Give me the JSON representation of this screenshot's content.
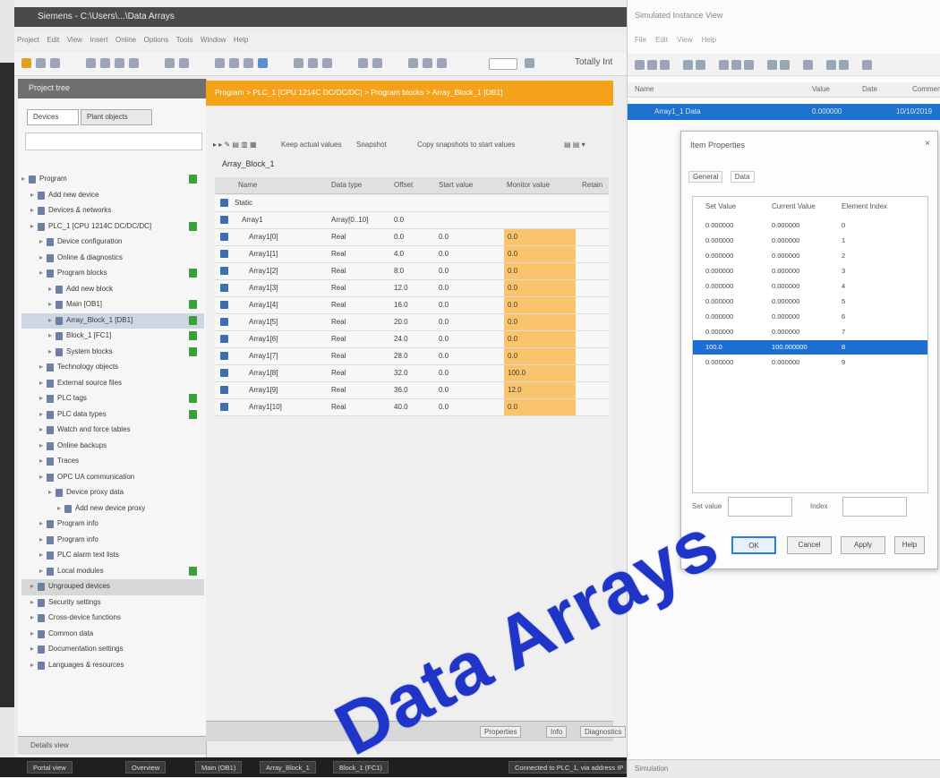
{
  "main_window": {
    "title": "Siemens - C:\\Users\\...\\Data Arrays",
    "menu": [
      "Project",
      "Edit",
      "View",
      "Insert",
      "Online",
      "Options",
      "Tools",
      "Window",
      "Help"
    ],
    "toolbar_label": "Totally Int"
  },
  "project_tree": {
    "header": "Project tree",
    "tabs": [
      "Devices",
      "Plant objects"
    ],
    "items": [
      {
        "label": "Program",
        "level": 0,
        "check": true
      },
      {
        "label": "Add new device",
        "level": 1,
        "check": false
      },
      {
        "label": "Devices & networks",
        "level": 1,
        "check": false
      },
      {
        "label": "PLC_1 [CPU 1214C DC/DC/DC]",
        "level": 1,
        "check": true
      },
      {
        "label": "Device configuration",
        "level": 2,
        "check": false
      },
      {
        "label": "Online & diagnostics",
        "level": 2,
        "check": false
      },
      {
        "label": "Program blocks",
        "level": 2,
        "check": true
      },
      {
        "label": "Add new block",
        "level": 3,
        "check": false
      },
      {
        "label": "Main [OB1]",
        "level": 3,
        "check": true
      },
      {
        "label": "Array_Block_1 [DB1]",
        "level": 3,
        "check": true,
        "selected": true
      },
      {
        "label": "Block_1 [FC1]",
        "level": 3,
        "check": true
      },
      {
        "label": "System blocks",
        "level": 3,
        "check": true
      },
      {
        "label": "Technology objects",
        "level": 2,
        "check": false
      },
      {
        "label": "External source files",
        "level": 2,
        "check": false
      },
      {
        "label": "PLC tags",
        "level": 2,
        "check": true
      },
      {
        "label": "PLC data types",
        "level": 2,
        "check": true
      },
      {
        "label": "Watch and force tables",
        "level": 2,
        "check": false
      },
      {
        "label": "Online backups",
        "level": 2,
        "check": false
      },
      {
        "label": "Traces",
        "level": 2,
        "check": false
      },
      {
        "label": "OPC UA communication",
        "level": 2,
        "check": false
      },
      {
        "label": "Device proxy data",
        "level": 3,
        "check": false
      },
      {
        "label": "Add new device proxy",
        "level": 4,
        "check": false
      },
      {
        "label": "Program info",
        "level": 2,
        "check": false
      },
      {
        "label": "Program info",
        "level": 2,
        "check": false
      },
      {
        "label": "PLC alarm text lists",
        "level": 2,
        "check": false
      },
      {
        "label": "Local modules",
        "level": 2,
        "check": true
      },
      {
        "label": "Ungrouped devices",
        "level": 1,
        "check": false,
        "dark": true
      },
      {
        "label": "Security settings",
        "level": 1,
        "check": false
      },
      {
        "label": "Cross-device functions",
        "level": 1,
        "check": false
      },
      {
        "label": "Common data",
        "level": 1,
        "check": false
      },
      {
        "label": "Documentation settings",
        "level": 1,
        "check": false
      },
      {
        "label": "Languages & resources",
        "level": 1,
        "check": false
      }
    ],
    "details_view": "Details view"
  },
  "breadcrumb": "Program > PLC_1 [CPU 1214C DC/DC/DC] > Program blocks > Array_Block_1 [DB1]",
  "editor": {
    "toolbar_items": [
      "Keep actual values",
      "Snapshot",
      "Copy snapshots to start values"
    ],
    "block_title": "Array_Block_1",
    "columns": [
      "Name",
      "Data type",
      "Offset",
      "Start value",
      "Monitor value",
      "Retain"
    ],
    "static_label": "Static",
    "array_row": {
      "name": "Array1",
      "type": "Array[0..10]",
      "offset": "0.0"
    },
    "rows": [
      {
        "name": "Array1[0]",
        "type": "Real",
        "offset": "0.0",
        "start": "0.0",
        "monitor": "0.0"
      },
      {
        "name": "Array1[1]",
        "type": "Real",
        "offset": "4.0",
        "start": "0.0",
        "monitor": "0.0"
      },
      {
        "name": "Array1[2]",
        "type": "Real",
        "offset": "8.0",
        "start": "0.0",
        "monitor": "0.0"
      },
      {
        "name": "Array1[3]",
        "type": "Real",
        "offset": "12.0",
        "start": "0.0",
        "monitor": "0.0"
      },
      {
        "name": "Array1[4]",
        "type": "Real",
        "offset": "16.0",
        "start": "0.0",
        "monitor": "0.0"
      },
      {
        "name": "Array1[5]",
        "type": "Real",
        "offset": "20.0",
        "start": "0.0",
        "monitor": "0.0"
      },
      {
        "name": "Array1[6]",
        "type": "Real",
        "offset": "24.0",
        "start": "0.0",
        "monitor": "0.0"
      },
      {
        "name": "Array1[7]",
        "type": "Real",
        "offset": "28.0",
        "start": "0.0",
        "monitor": "0.0"
      },
      {
        "name": "Array1[8]",
        "type": "Real",
        "offset": "32.0",
        "start": "0.0",
        "monitor": "100.0"
      },
      {
        "name": "Array1[9]",
        "type": "Real",
        "offset": "36.0",
        "start": "0.0",
        "monitor": "12.0"
      },
      {
        "name": "Array1[10]",
        "type": "Real",
        "offset": "40.0",
        "start": "0.0",
        "monitor": "0.0"
      }
    ],
    "bottom_tabs": [
      "Properties",
      "Info",
      "Diagnostics"
    ]
  },
  "taskbar": {
    "items": [
      "Portal view",
      "Overview",
      "Main (OB1)",
      "Array_Block_1",
      "Block_1 (FC1)",
      "Connected to PLC_1, via address IP"
    ]
  },
  "right_window": {
    "title": "Simulated Instance View",
    "menu": [
      "File",
      "Edit",
      "View",
      "Help"
    ],
    "columns": [
      "Name",
      "Value",
      "Date",
      "Comment"
    ],
    "selected_row": {
      "name": "Array1_1 Data",
      "value": "0.000000",
      "extra": "10/10/2019"
    },
    "status": "Simulation"
  },
  "dialog": {
    "title": "Item Properties",
    "tabs": [
      "General",
      "Data"
    ],
    "columns": [
      "Set Value",
      "Current Value",
      "Element Index"
    ],
    "rows": [
      {
        "set": "0.000000",
        "cur": "0.000000",
        "idx": "0"
      },
      {
        "set": "0.000000",
        "cur": "0.000000",
        "idx": "1"
      },
      {
        "set": "0.000000",
        "cur": "0.000000",
        "idx": "2"
      },
      {
        "set": "0.000000",
        "cur": "0.000000",
        "idx": "3"
      },
      {
        "set": "0.000000",
        "cur": "0.000000",
        "idx": "4"
      },
      {
        "set": "0.000000",
        "cur": "0.000000",
        "idx": "5"
      },
      {
        "set": "0.000000",
        "cur": "0.000000",
        "idx": "6"
      },
      {
        "set": "0.000000",
        "cur": "0.000000",
        "idx": "7"
      },
      {
        "set": "100.0",
        "cur": "100.000000",
        "idx": "8",
        "selected": true
      },
      {
        "set": "0.000000",
        "cur": "0.000000",
        "idx": "9"
      }
    ],
    "field_label_1": "Set value",
    "field_label_2": "Index",
    "buttons": [
      "OK",
      "Cancel",
      "Apply",
      "Help"
    ]
  },
  "overlay_text": "Data Arrays",
  "colors": {
    "breadcrumb": "#f5a21b",
    "highlight": "#f9c46c",
    "selection": "#1c72cc",
    "overlay": "#1e35c8",
    "status_check": "#3aa03a"
  }
}
